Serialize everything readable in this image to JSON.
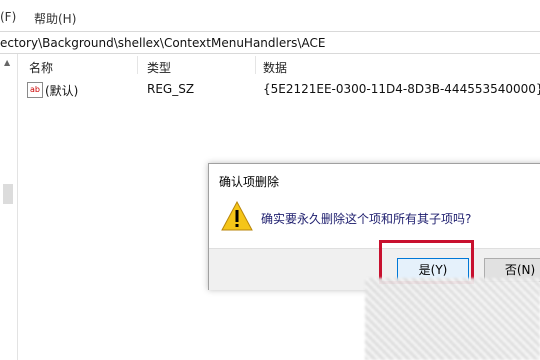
{
  "menubar": {
    "items": [
      {
        "label": "(F)"
      },
      {
        "label": "帮助(H)"
      }
    ]
  },
  "address": {
    "path": "ectory\\Background\\shellex\\ContextMenuHandlers\\ACE"
  },
  "list": {
    "columns": [
      "名称",
      "类型",
      "数据"
    ],
    "rows": [
      {
        "icon": "ab",
        "name": "(默认)",
        "type": "REG_SZ",
        "data": "{5E2121EE-0300-11D4-8D3B-444553540000}"
      }
    ]
  },
  "dialog": {
    "title": "确认项删除",
    "message": "确实要永久删除这个项和所有其子项吗?",
    "yes_label": "是(Y)",
    "no_label": "否(N)"
  },
  "colors": {
    "highlight": "#c8102e",
    "warning": "#f5c518"
  }
}
